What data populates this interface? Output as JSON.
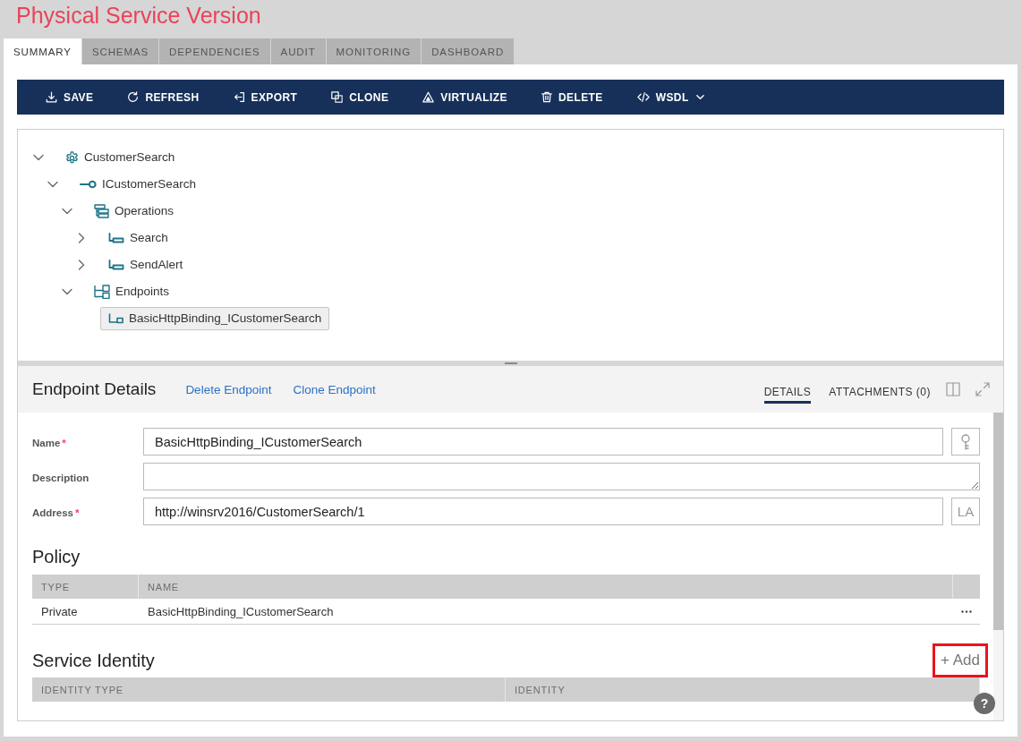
{
  "title": "Physical Service Version",
  "tabs": [
    {
      "label": "SUMMARY",
      "selected": true
    },
    {
      "label": "SCHEMAS",
      "selected": false
    },
    {
      "label": "DEPENDENCIES",
      "selected": false
    },
    {
      "label": "AUDIT",
      "selected": false
    },
    {
      "label": "MONITORING",
      "selected": false
    },
    {
      "label": "DASHBOARD",
      "selected": false
    }
  ],
  "toolbar": [
    {
      "label": "SAVE",
      "kind": "save",
      "dropdown": false
    },
    {
      "label": "REFRESH",
      "kind": "refresh",
      "dropdown": false
    },
    {
      "label": "EXPORT",
      "kind": "export",
      "dropdown": false
    },
    {
      "label": "CLONE",
      "kind": "clone",
      "dropdown": false
    },
    {
      "label": "VIRTUALIZE",
      "kind": "virtualize",
      "dropdown": false
    },
    {
      "label": "DELETE",
      "kind": "delete",
      "dropdown": false
    },
    {
      "label": "WSDL",
      "kind": "code",
      "dropdown": true
    }
  ],
  "tree": [
    {
      "label": "CustomerSearch",
      "kind": "service",
      "expanded": true,
      "selected": false,
      "children": [
        {
          "label": "ICustomerSearch",
          "kind": "interface",
          "expanded": true,
          "selected": false,
          "children": [
            {
              "label": "Operations",
              "kind": "operations",
              "expanded": true,
              "selected": false,
              "children": [
                {
                  "label": "Search",
                  "kind": "operation",
                  "expanded": false,
                  "selected": false
                },
                {
                  "label": "SendAlert",
                  "kind": "operation",
                  "expanded": false,
                  "selected": false
                }
              ]
            },
            {
              "label": "Endpoints",
              "kind": "endpoints",
              "expanded": true,
              "selected": false,
              "children": [
                {
                  "label": "BasicHttpBinding_ICustomerSearch",
                  "kind": "endpoint",
                  "selected": true
                }
              ]
            }
          ]
        }
      ]
    }
  ],
  "details": {
    "title": "Endpoint Details",
    "links": [
      "Delete Endpoint",
      "Clone Endpoint"
    ],
    "tabs": [
      {
        "label": "DETAILS",
        "selected": true
      },
      {
        "label": "ATTACHMENTS (0)",
        "selected": false
      }
    ],
    "fields": [
      {
        "label": "Name",
        "required_mark": "*",
        "kind": "input",
        "value": "BasicHttpBinding_ICustomerSearch",
        "button": {
          "kind": "key"
        }
      },
      {
        "label": "Description",
        "kind": "textarea"
      },
      {
        "label": "Address",
        "required_mark": "*",
        "kind": "input",
        "value": "http://winsrv2016/CustomerSearch/1",
        "button": {
          "kind": "text",
          "label": "LA"
        }
      }
    ],
    "policy": {
      "title": "Policy",
      "columns": [
        "TYPE",
        "NAME"
      ],
      "rows": [
        {
          "cells": [
            "Private",
            "BasicHttpBinding_ICustomerSearch"
          ]
        }
      ]
    },
    "service_identity": {
      "title": "Service Identity",
      "add_button": {
        "label": "+ Add",
        "highlighted": true
      },
      "columns": [
        "IDENTITY TYPE",
        "IDENTITY"
      ]
    }
  },
  "help_button": {
    "label": "?"
  }
}
